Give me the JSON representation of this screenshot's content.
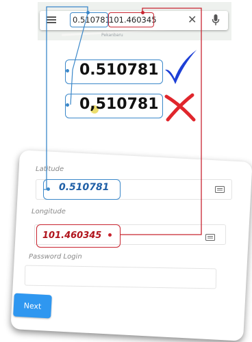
{
  "search": {
    "latitude_text": "0.510781",
    "longitude_text": "101.460345",
    "map_label": "Pekanbaru"
  },
  "comparison": {
    "correct_value": "0.510781",
    "incorrect_value": "0,510781",
    "correct_mark": "checkmark-icon",
    "incorrect_mark": "cross-icon"
  },
  "form": {
    "latitude_label": "Latitude",
    "latitude_value": "0.510781",
    "longitude_label": "Longitude",
    "longitude_value": "101.460345",
    "password_label": "Password Login",
    "password_value": "",
    "next_label": "Next"
  },
  "colors": {
    "latitude_annotation": "#3a87c9",
    "longitude_annotation": "#c8242f",
    "check": "#1d3fd6",
    "cross": "#e0262c",
    "button": "#2f97f0"
  }
}
